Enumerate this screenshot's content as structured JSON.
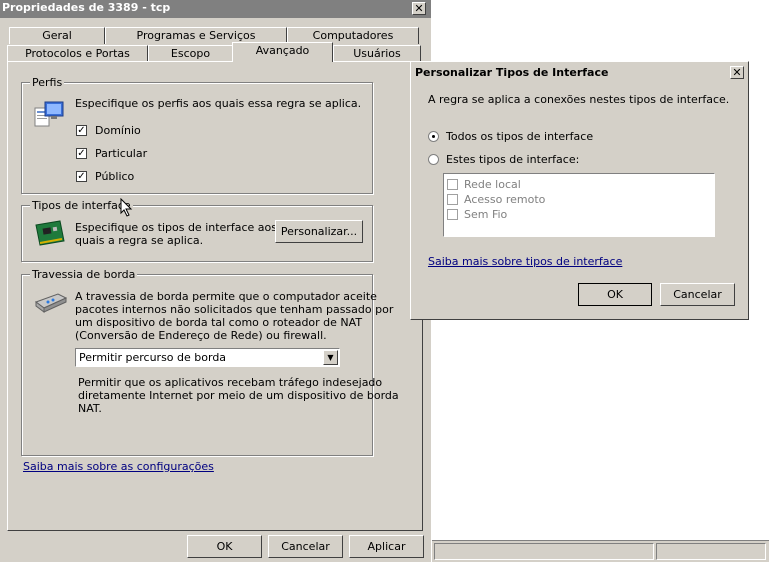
{
  "main_dialog": {
    "title": "Propriedades de 3389 - tcp",
    "close_glyph": "✕",
    "tabs_row1": [
      {
        "label": "Geral"
      },
      {
        "label": "Programas e Serviços"
      },
      {
        "label": "Computadores"
      }
    ],
    "tabs_row2": [
      {
        "label": "Protocolos e Portas"
      },
      {
        "label": "Escopo"
      },
      {
        "label": "Avançado",
        "active": true
      },
      {
        "label": "Usuários"
      }
    ],
    "profiles": {
      "legend": "Perfis",
      "description": "Especifique os perfis aos quais essa regra se aplica.",
      "items": [
        {
          "label": "Domínio",
          "checked": true
        },
        {
          "label": "Particular",
          "checked": true
        },
        {
          "label": "Público",
          "checked": true
        }
      ]
    },
    "interface_types": {
      "legend": "Tipos de interface",
      "description_line1": "Especifique os tipos de interface aos",
      "description_line2": "quais a regra se aplica.",
      "customize_button": "Personalizar..."
    },
    "edge_traversal": {
      "legend": "Travessia de borda",
      "description_lines": [
        "A travessia de borda permite que o computador aceite",
        "pacotes internos não solicitados que tenham passado por",
        "um dispositivo de borda tal como o roteador de NAT",
        "(Conversão de Endereço de Rede) ou firewall."
      ],
      "selected_option": "Permitir percurso de borda",
      "help_lines": [
        "Permitir que os aplicativos recebam tráfego indesejado",
        "diretamente Internet por meio de um dispositivo de borda",
        "NAT."
      ]
    },
    "learn_more_link": "Saiba mais sobre as configurações",
    "buttons": {
      "ok": "OK",
      "cancel": "Cancelar",
      "apply": "Aplicar"
    }
  },
  "custom_dialog": {
    "title": "Personalizar Tipos de Interface",
    "close_glyph": "✕",
    "description": "A regra se aplica a conexões nestes tipos de interface.",
    "radio_all": "Todos os tipos de interface",
    "radio_these": "Estes tipos  de interface:",
    "selected_radio": "all",
    "interface_options": [
      {
        "label": "Rede local",
        "checked": false
      },
      {
        "label": "Acesso remoto",
        "checked": false
      },
      {
        "label": "Sem Fio",
        "checked": false
      }
    ],
    "learn_more_link": "Saiba mais sobre tipos de interface",
    "buttons": {
      "ok": "OK",
      "cancel": "Cancelar"
    }
  },
  "colors": {
    "dialog_face": "#d4d0c8",
    "inactive_titlebar": "#808080",
    "link": "#000080"
  }
}
